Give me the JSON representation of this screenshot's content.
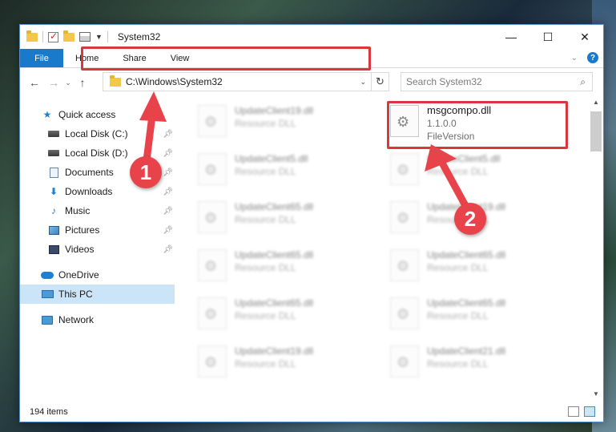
{
  "window": {
    "title": "System32",
    "controls": {
      "minimize": "—",
      "maximize": "☐",
      "close": "✕"
    }
  },
  "ribbon": {
    "tabs": [
      "File",
      "Home",
      "Share",
      "View"
    ]
  },
  "nav": {
    "address": "C:\\Windows\\System32",
    "search_placeholder": "Search System32"
  },
  "sidebar": {
    "quick_access": "Quick access",
    "items": [
      {
        "label": "Local Disk (C:)",
        "icon": "drive-icon"
      },
      {
        "label": "Local Disk (D:)",
        "icon": "drive-icon"
      },
      {
        "label": "Documents",
        "icon": "documents-icon"
      },
      {
        "label": "Downloads",
        "icon": "downloads-icon"
      },
      {
        "label": "Music",
        "icon": "music-icon"
      },
      {
        "label": "Pictures",
        "icon": "pictures-icon"
      },
      {
        "label": "Videos",
        "icon": "videos-icon"
      }
    ],
    "onedrive": "OneDrive",
    "this_pc": "This PC",
    "network": "Network"
  },
  "files": {
    "left_column": [
      {
        "name": "UpdateClient19.dll",
        "desc": "Resource DLL"
      },
      {
        "name": "UpdateClient5.dll",
        "desc": "Resource DLL"
      },
      {
        "name": "UpdateClient65.dll",
        "desc": "Resource DLL"
      },
      {
        "name": "UpdateClient65.dll",
        "desc": "Resource DLL"
      },
      {
        "name": "UpdateClient65.dll",
        "desc": "Resource DLL"
      },
      {
        "name": "UpdateClient19.dll",
        "desc": "Resource DLL"
      }
    ],
    "right_column": [
      {
        "name": "msgcompo.dll",
        "version": "1.1.0.0",
        "desc": "FileVersion"
      },
      {
        "name": "UpdateClient5.dll",
        "desc": "Resource DLL"
      },
      {
        "name": "UpdateClient19.dll",
        "desc": "Resource DLL"
      },
      {
        "name": "UpdateClient65.dll",
        "desc": "Resource DLL"
      },
      {
        "name": "UpdateClient65.dll",
        "desc": "Resource DLL"
      },
      {
        "name": "UpdateClient21.dll",
        "desc": "Resource DLL"
      }
    ]
  },
  "status": {
    "item_count": "194 items"
  },
  "annotations": {
    "callout_1": "1",
    "callout_2": "2",
    "highlight_color": "#d9363e"
  },
  "colors": {
    "accent": "#1979ca",
    "selected": "#cce4f7"
  }
}
